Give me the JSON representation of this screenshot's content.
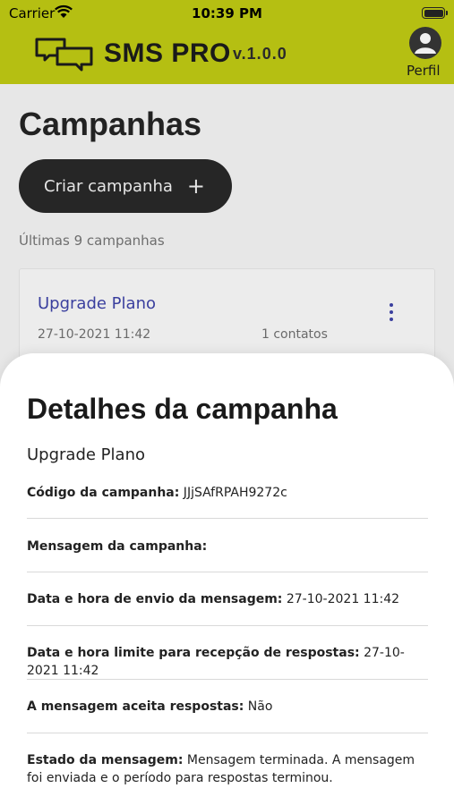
{
  "status_bar": {
    "carrier": "Carrier",
    "time": "10:39 PM",
    "icons": [
      "wifi-icon",
      "battery-icon"
    ]
  },
  "header": {
    "brand": "SMS PRO",
    "version": "v.1.0.0",
    "profile_label": "Perfil",
    "accent_color": "#b5bf12"
  },
  "main": {
    "title": "Campanhas",
    "create_button": "Criar campanha",
    "create_icon": "+",
    "recent_label": "Últimas 9 campanhas",
    "campaigns": [
      {
        "name": "Upgrade Plano",
        "date": "27-10-2021 11:42",
        "contacts": "1 contatos"
      }
    ]
  },
  "details": {
    "title": "Detalhes da campanha",
    "campaign_name": "Upgrade Plano",
    "fields": [
      {
        "label": "Código da campanha:",
        "value": " JJjSAfRPAH9272c"
      },
      {
        "label": "Mensagem da campanha:",
        "value": ""
      },
      {
        "label": "Data e hora de envio da mensagem:",
        "value": " 27-10-2021 11:42"
      },
      {
        "label": "Data e hora limite para recepção de respostas:",
        "value": " 27-10-2021 11:42"
      },
      {
        "label": "A mensagem aceita respostas:",
        "value": " Não"
      },
      {
        "label": "Estado da mensagem:",
        "value": " Mensagem terminada. A mensagem foi enviada e o período para respostas terminou."
      }
    ]
  }
}
